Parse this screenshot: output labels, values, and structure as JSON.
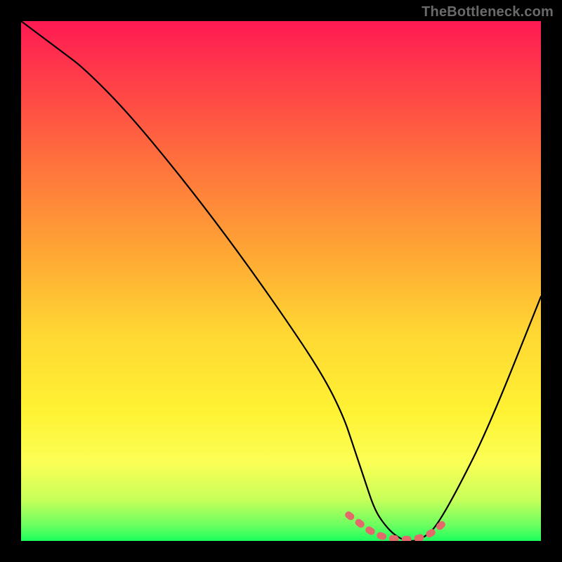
{
  "watermark": "TheBottleneck.com",
  "chart_data": {
    "type": "line",
    "title": "",
    "xlabel": "",
    "ylabel": "",
    "xlim": [
      0,
      100
    ],
    "ylim": [
      0,
      100
    ],
    "series": [
      {
        "name": "bottleneck-curve",
        "x": [
          0,
          4,
          8,
          12,
          20,
          30,
          40,
          50,
          58,
          62,
          64,
          66,
          68,
          70,
          72,
          74,
          76,
          78,
          80,
          84,
          90,
          100
        ],
        "values": [
          100,
          97,
          94,
          91,
          83,
          71,
          58,
          44,
          32,
          24,
          18,
          12,
          6,
          3,
          1,
          0,
          0,
          1,
          3,
          10,
          22,
          47
        ]
      },
      {
        "name": "optimal-range-marker",
        "x": [
          63,
          65,
          67,
          69,
          71,
          73,
          75,
          77,
          79,
          81
        ],
        "values": [
          5,
          3.5,
          2,
          1,
          0.5,
          0.3,
          0.3,
          0.6,
          1.5,
          3.2
        ]
      }
    ],
    "gradient_stops": [
      {
        "pos": 0,
        "color": "#ff1a53"
      },
      {
        "pos": 10,
        "color": "#ff3a4a"
      },
      {
        "pos": 25,
        "color": "#ff6a3e"
      },
      {
        "pos": 45,
        "color": "#ffa834"
      },
      {
        "pos": 60,
        "color": "#ffd733"
      },
      {
        "pos": 75,
        "color": "#fff233"
      },
      {
        "pos": 85,
        "color": "#fbff55"
      },
      {
        "pos": 92,
        "color": "#c8ff5a"
      },
      {
        "pos": 97,
        "color": "#6bff60"
      },
      {
        "pos": 100,
        "color": "#1bff5e"
      }
    ],
    "colors": {
      "curve": "#000000",
      "marker": "#e26a6a",
      "frame": "#000000"
    }
  }
}
